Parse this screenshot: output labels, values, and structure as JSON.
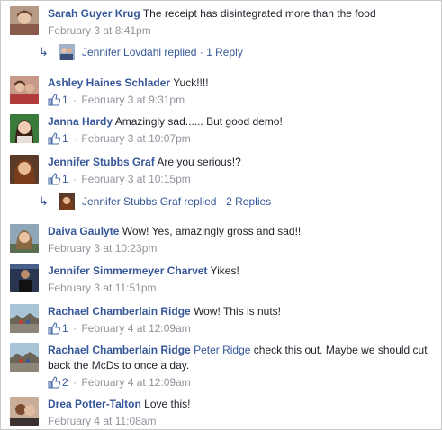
{
  "comments": [
    {
      "author": "Sarah Guyer Krug",
      "text": "The receipt has disintegrated more than the food",
      "mention": "",
      "likes": "",
      "time": "February 3 at 8:41pm",
      "reply": {
        "author": "Jennifer Lovdahl",
        "action": "replied",
        "count": "1 Reply"
      }
    },
    {
      "author": "Ashley Haines Schlader",
      "text": "Yuck!!!!",
      "mention": "",
      "likes": "1",
      "time": "February 3 at 9:31pm"
    },
    {
      "author": "Janna Hardy",
      "text": "Amazingly sad...... But good demo!",
      "mention": "",
      "likes": "1",
      "time": "February 3 at 10:07pm"
    },
    {
      "author": "Jennifer Stubbs Graf",
      "text": "Are you serious!?",
      "mention": "",
      "likes": "1",
      "time": "February 3 at 10:15pm",
      "reply": {
        "author": "Jennifer Stubbs Graf",
        "action": "replied",
        "count": "2 Replies"
      }
    },
    {
      "author": "Daiva Gaulyte",
      "text": "Wow! Yes, amazingly gross and sad!!",
      "mention": "",
      "likes": "",
      "time": "February 3 at 10:23pm"
    },
    {
      "author": "Jennifer Simmermeyer Charvet",
      "text": "Yikes!",
      "mention": "",
      "likes": "",
      "time": "February 3 at 11:51pm"
    },
    {
      "author": "Rachael Chamberlain Ridge",
      "text": "Wow! This is nuts!",
      "mention": "",
      "likes": "1",
      "time": "February 4 at 12:09am"
    },
    {
      "author": "Rachael Chamberlain Ridge",
      "mention": "Peter Ridge",
      "text": "check this out. Maybe we should cut back the McDs to once a day.",
      "likes": "2",
      "time": "February 4 at 12:09am"
    },
    {
      "author": "Drea Potter-Talton",
      "text": "Love this!",
      "mention": "",
      "likes": "",
      "time": "February 4 at 11:08am"
    }
  ],
  "separator": "·",
  "icons": {
    "like": "thumbs-up-icon",
    "reply_arrow": "reply-arrow-icon"
  },
  "colors": {
    "link": "#365899",
    "meta": "#90949c",
    "text": "#1d2129",
    "border": "#c9c9c9"
  }
}
